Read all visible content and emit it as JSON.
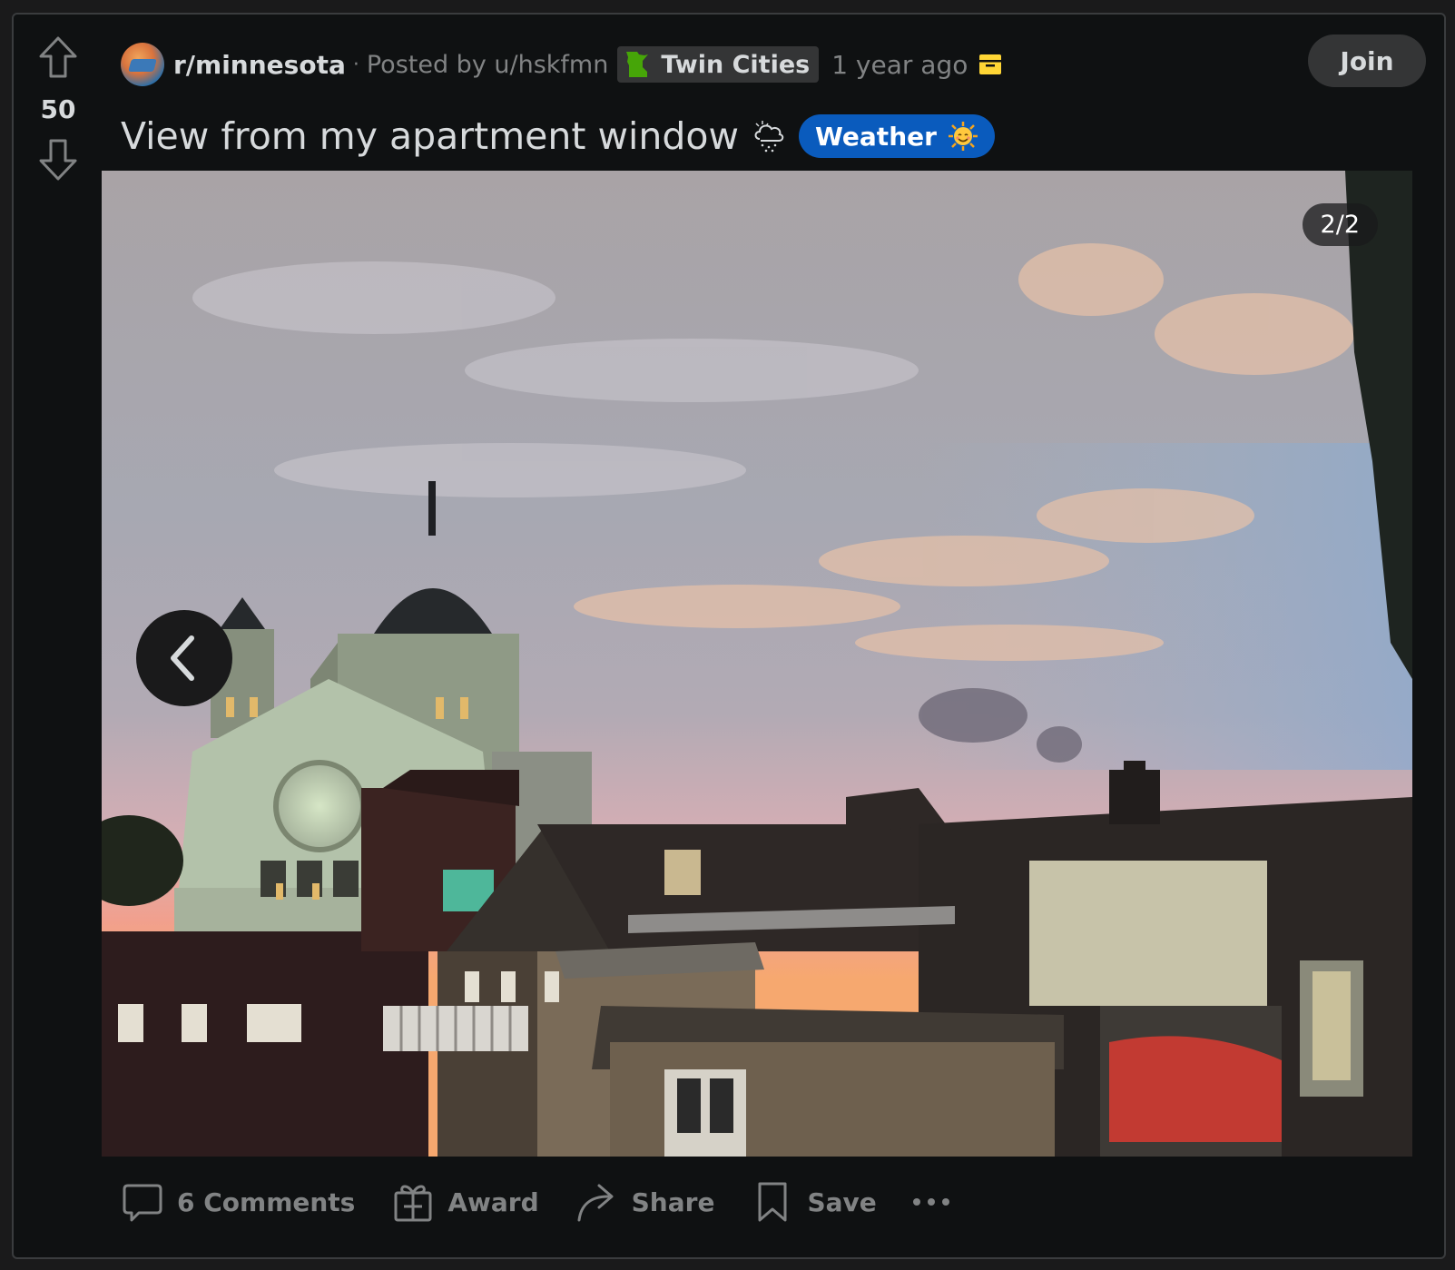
{
  "post": {
    "subreddit": "r/minnesota",
    "separator": "·",
    "posted_by": "Posted by u/hskfmn",
    "user_flair": "Twin Cities",
    "time_ago": "1 year ago",
    "join_label": "Join",
    "score": "50",
    "title": "View from my apartment window",
    "post_flair": "Weather",
    "gallery_counter": "2/2"
  },
  "actions": {
    "comments": "6 Comments",
    "award": "Award",
    "share": "Share",
    "save": "Save"
  },
  "icons": {
    "upvote": "arrow-up-outline-icon",
    "downvote": "arrow-down-outline-icon",
    "archived": "archive-box-icon",
    "title_emoji": "cloud-snow-icon",
    "flair_emoji": "smiling-sun-icon",
    "prev": "chevron-left-icon",
    "comments": "speech-bubble-icon",
    "award": "gift-icon",
    "share": "share-arrow-icon",
    "save": "bookmark-icon",
    "more": "ellipsis-icon"
  },
  "colors": {
    "background": "#0f1112",
    "border": "#3a3c3e",
    "text": "#d7dadc",
    "muted": "#818384",
    "flair_blue": "#0a5bbd",
    "archive_yellow": "#ffd635",
    "mn_green": "#46a508"
  }
}
